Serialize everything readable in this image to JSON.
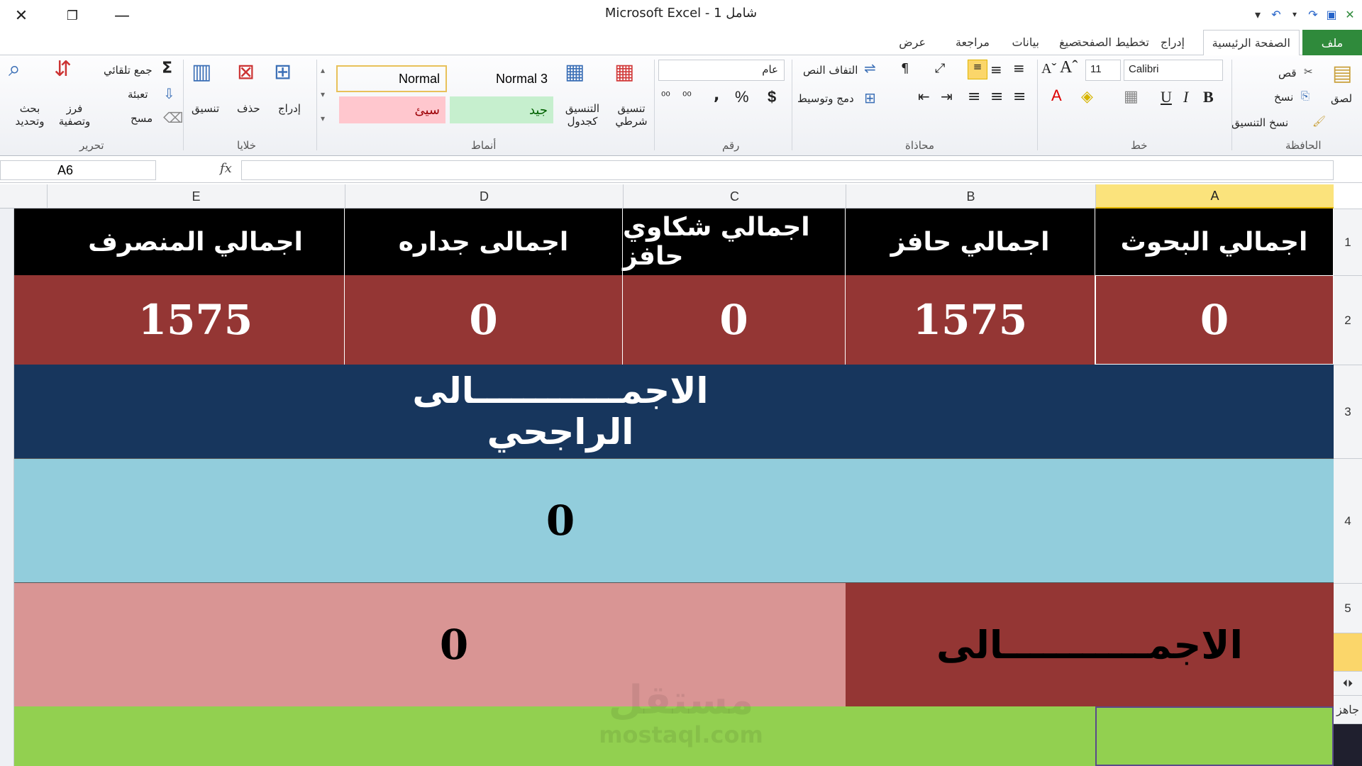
{
  "window": {
    "title": "شامل 1 - Microsoft Excel"
  },
  "tabs": {
    "file": "ملف",
    "home": "الصفحة الرئيسية",
    "insert": "إدراج",
    "page_layout": "تخطيط الصفحة",
    "formulas": "صيغ",
    "data": "بيانات",
    "review": "مراجعة",
    "view": "عرض"
  },
  "ribbon": {
    "clipboard": {
      "label": "الحافظة",
      "paste": "لصق",
      "cut": "قص",
      "copy": "نسخ",
      "format_painter": "نسخ التنسيق"
    },
    "font": {
      "label": "خط",
      "name": "Calibri",
      "size": "11",
      "bold": "B",
      "italic": "I",
      "underline": "U"
    },
    "alignment": {
      "label": "محاذاة",
      "wrap_text": "التفاف النص",
      "merge_center": "دمج وتوسيط"
    },
    "number": {
      "label": "رقم",
      "format": "عام"
    },
    "styles": {
      "label": "أنماط",
      "conditional": "تنسيق شرطي",
      "format_table": "التنسيق كجدول",
      "normal": "Normal",
      "normal3": "Normal 3",
      "good": "جيد",
      "bad": "سيئ"
    },
    "cells": {
      "label": "خلايا",
      "insert": "إدراج",
      "delete": "حذف",
      "format": "تنسيق"
    },
    "editing": {
      "label": "تحرير",
      "autosum": "جمع تلقائي",
      "fill": "تعبئة",
      "clear": "مسح",
      "sort_filter": "فرز وتصفية",
      "find_select": "بحث وتحديد"
    }
  },
  "formula_bar": {
    "name_box": "A6",
    "fx": "fx",
    "content": ""
  },
  "columns": [
    "A",
    "B",
    "C",
    "D",
    "E"
  ],
  "rows": [
    "1",
    "2",
    "3",
    "4",
    "5"
  ],
  "sheet": {
    "headers": [
      "اجمالي البحوث",
      "اجمالي حافز",
      "اجمالي شكاوي حافز",
      "اجمالى جداره",
      "اجمالي المنصرف"
    ],
    "values": [
      "0",
      "1575",
      "0",
      "0",
      "1575"
    ],
    "row3_title": "الاجمــــــــــــالى  الراجحي",
    "row4_value": "0",
    "row5_label": "الاجمـــــــــــالى",
    "row5_value": "0"
  },
  "status": {
    "ready": "جاهز"
  },
  "watermark": {
    "line1": "مستقل",
    "line2": "mostaql.com"
  },
  "colors": {
    "header_bg": "#000000",
    "value_bg": "#943634",
    "row3_bg": "#17365d",
    "row4_bg": "#92cddc",
    "row5_left_bg": "#d99594",
    "row6_bg": "#92d050",
    "selected_col": "#fbe37c"
  }
}
